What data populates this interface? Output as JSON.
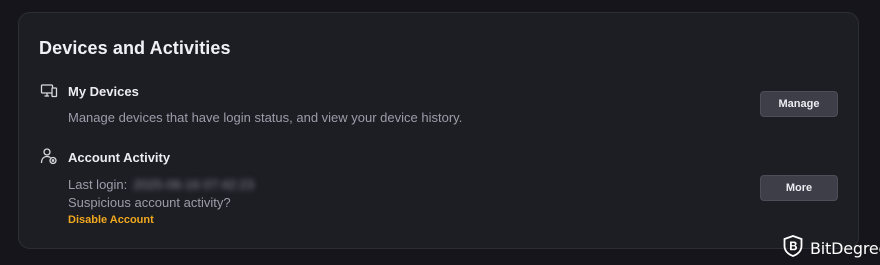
{
  "section": {
    "title": "Devices and Activities"
  },
  "devices": {
    "icon": "devices-icon",
    "title": "My Devices",
    "description": "Manage devices that have login status, and view your device history.",
    "button_label": "Manage"
  },
  "activity": {
    "icon": "user-activity-icon",
    "title": "Account Activity",
    "last_login_label": "Last login:",
    "last_login_value": "2025-06-16 07:42:23",
    "suspicious_text": "Suspicious account activity?",
    "disable_link": "Disable Account",
    "button_label": "More"
  },
  "watermark": {
    "logo_icon": "bitdegree-shield-icon",
    "text": "BitDegree"
  },
  "colors": {
    "background": "#15151b",
    "card": "#1d1d24",
    "button": "#3d3e48",
    "accent_link": "#f0a81e"
  }
}
